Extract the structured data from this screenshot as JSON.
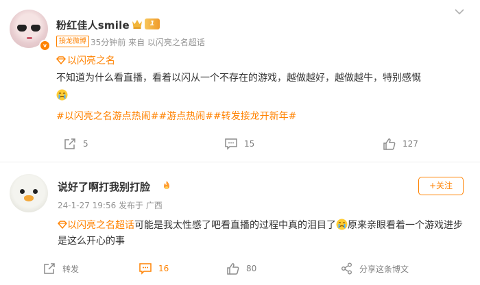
{
  "post": {
    "username": "粉红佳人smile",
    "level_badge": "1",
    "source_tag": "接龙微博",
    "meta": "35分钟前  来自 以闪亮之名超话",
    "supertopic": "以闪亮之名",
    "text": "不知道为什么看直播，看着以闪从一个不存在的游戏，越做越好，越做越牛，特别感慨",
    "hashtags": "#以闪亮之名游点热闹##游点热闹##转发接龙开新年#",
    "actions": {
      "share_count": "5",
      "comment_count": "15",
      "like_count": "127"
    }
  },
  "comment": {
    "username": "说好了啊打我别打脸",
    "meta": "24-1-27 19:56  发布于 广西",
    "follow_label": "+关注",
    "supertopic_prefix": "以闪亮之名超话",
    "text_part1": "可能是我太性感了吧看直播的过程中真的泪目了",
    "text_part2": "原来亲眼看着一个游戏进步是这么开心的事",
    "actions": {
      "share_label": "转发",
      "comment_count": "16",
      "like_count": "80",
      "repost_label": "分享这条博文"
    }
  },
  "colors": {
    "accent": "#ff8200",
    "meta_gray": "#939393",
    "text": "#333333"
  },
  "icons": {
    "verified_badge": "v-badge-icon",
    "crown": "crown-icon",
    "share": "share-icon",
    "comment": "comment-icon",
    "like": "thumbs-up-icon",
    "more": "chevron-down-icon"
  }
}
